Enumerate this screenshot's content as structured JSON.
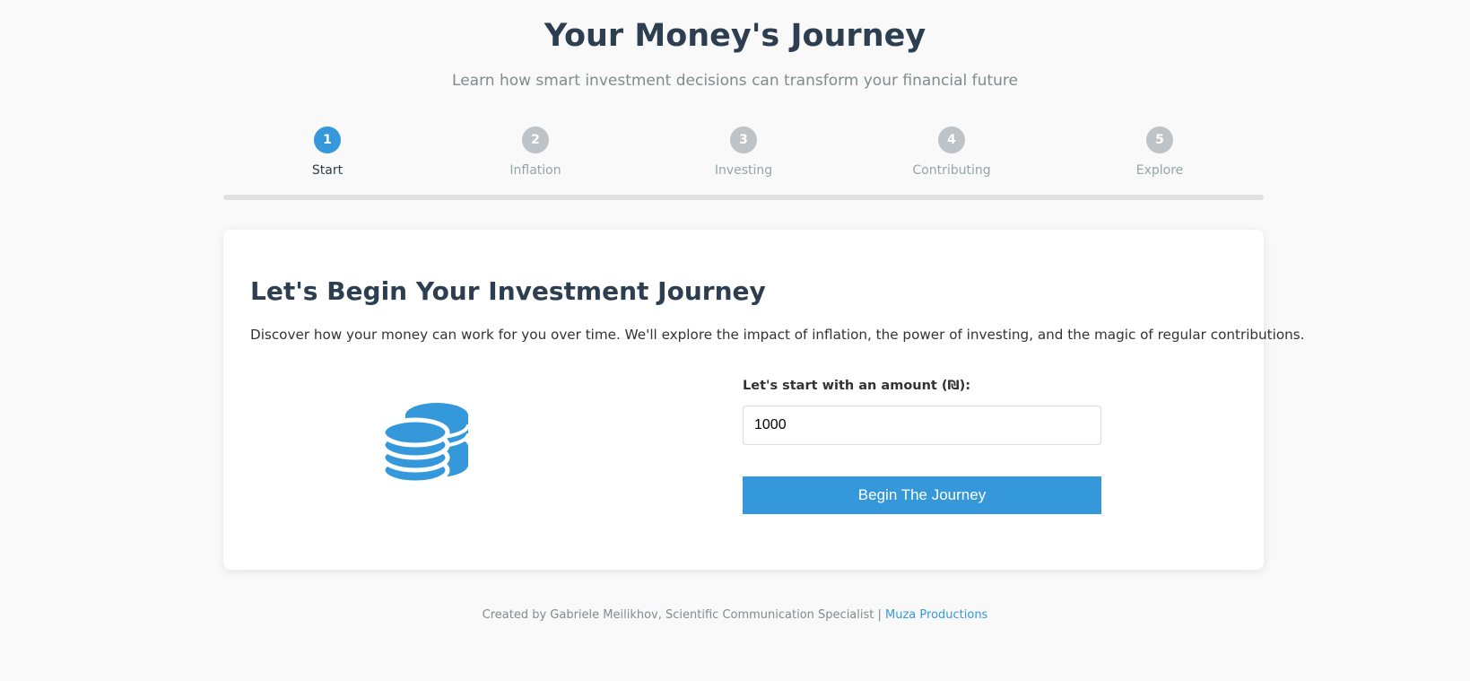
{
  "header": {
    "title": "Your Money's Journey",
    "subtitle": "Learn how smart investment decisions can transform your financial future"
  },
  "steps": [
    {
      "number": "1",
      "label": "Start",
      "active": true
    },
    {
      "number": "2",
      "label": "Inflation",
      "active": false
    },
    {
      "number": "3",
      "label": "Investing",
      "active": false
    },
    {
      "number": "4",
      "label": "Contributing",
      "active": false
    },
    {
      "number": "5",
      "label": "Explore",
      "active": false
    }
  ],
  "progress": {
    "fraction": 0
  },
  "card": {
    "heading": "Let's Begin Your Investment Journey",
    "description": "Discover how your money can work for you over time. We'll explore the impact of inflation, the power of investing, and the magic of regular contributions.",
    "icon": "coins-icon",
    "amount_label": "Let's start with an amount (₪):",
    "amount_value": "1000",
    "button_label": "Begin The Journey"
  },
  "footer": {
    "credit": "Created by Gabriele Meilikhov, Scientific Communication Specialist | ",
    "link_label": "Muza Productions"
  },
  "colors": {
    "accent": "#3498db",
    "heading": "#2c3e50",
    "muted": "#7f8c8d",
    "inactive_step": "#bdc3c7"
  }
}
